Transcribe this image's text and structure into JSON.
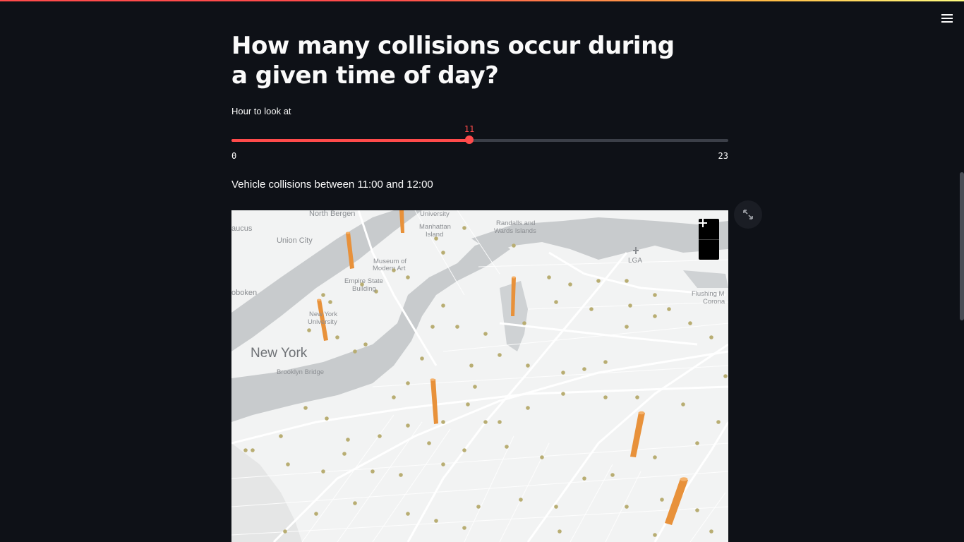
{
  "app": {
    "menu_icon": "hamburger-menu-icon",
    "accent_color": "#ff4b4b",
    "background_color": "#0e1117"
  },
  "page": {
    "title": "How many collisions occur during a given time of day?"
  },
  "slider": {
    "label": "Hour to look at",
    "value": "11",
    "min": "0",
    "max": "23",
    "value_num": 11,
    "min_num": 0,
    "max_num": 23
  },
  "map": {
    "caption": "Vehicle collisions between 11:00 and 12:00",
    "zoom_in_icon": "plus-icon",
    "zoom_out_icon": "minus-icon",
    "fullscreen_icon": "expand-icon",
    "column_color": "#e8913a",
    "hex_color": "#b8ad72",
    "labels": {
      "north_bergen": "North Bergen",
      "university": "University",
      "manhattan": "Manhattan",
      "island": "Island",
      "randalls": "Randalls and",
      "wards": "Wards Islands",
      "secaucus": "aucus",
      "union_city": "Union City",
      "museum1": "Museum of",
      "museum2": "Modern Art",
      "lga": "LGA",
      "hoboken": "oboken",
      "empire1": "Empire State",
      "empire2": "Building",
      "flushing1": "Flushing M",
      "flushing2": "Corona",
      "nyu1": "New York",
      "nyu2": "University",
      "new_york": "New York",
      "brooklyn_bridge": "Brooklyn Bridge"
    }
  }
}
